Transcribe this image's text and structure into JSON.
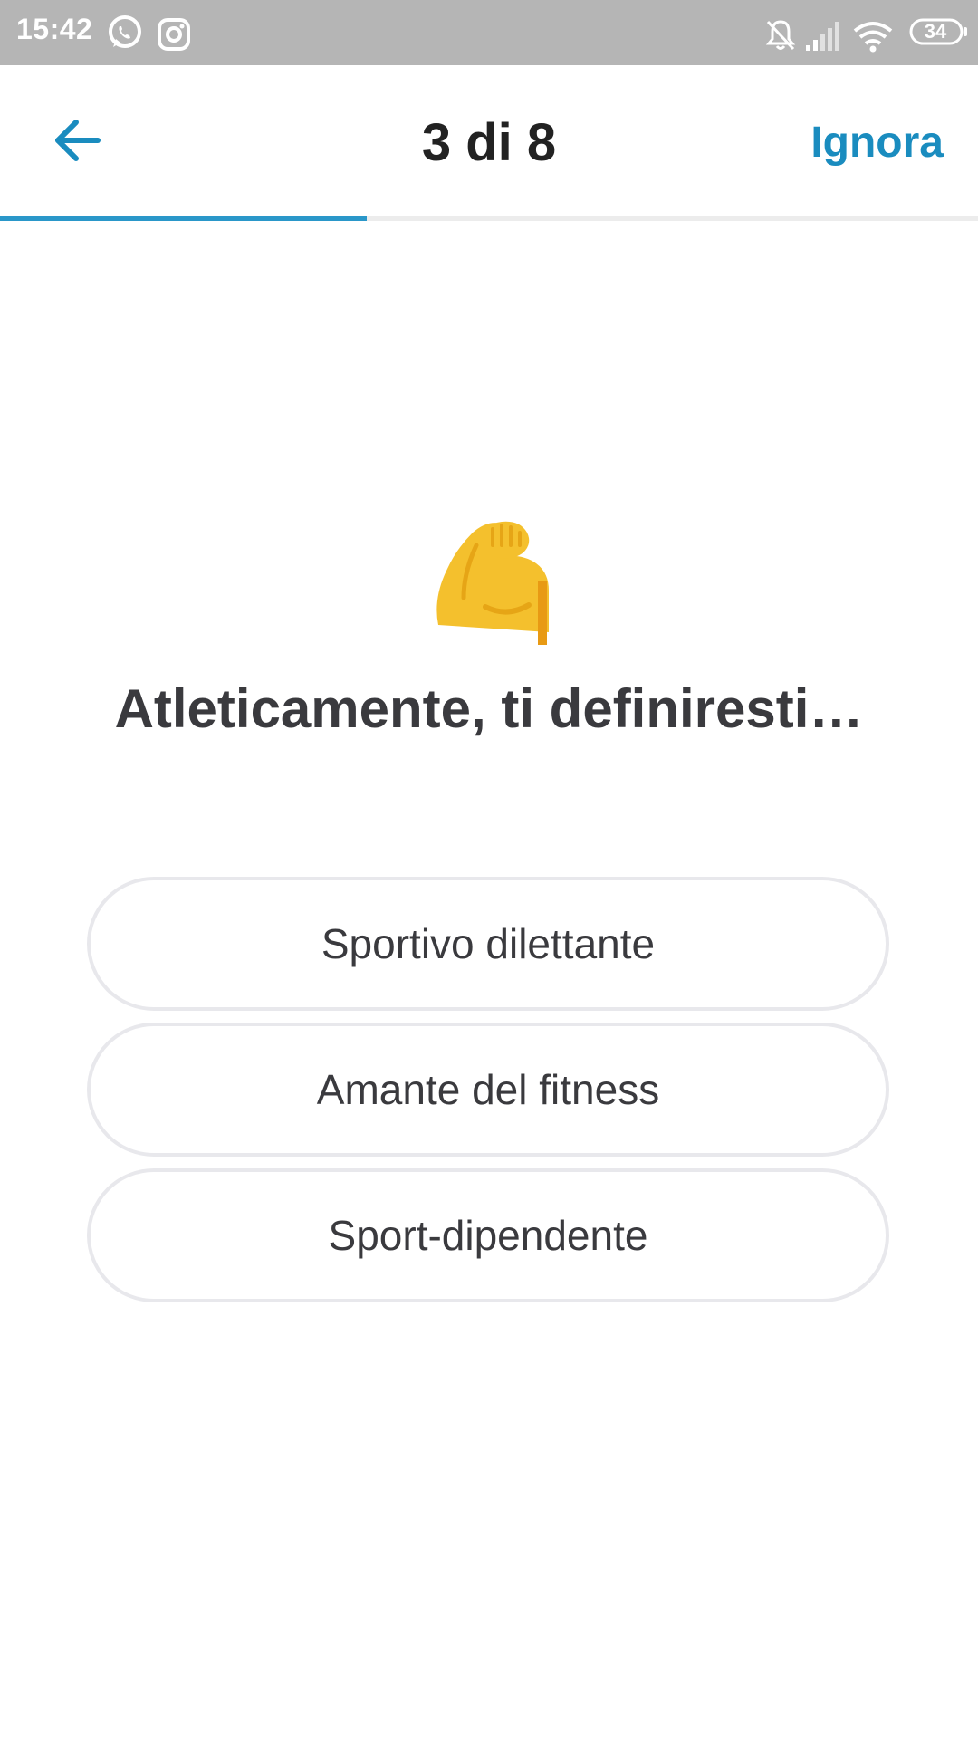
{
  "status_bar": {
    "time": "15:42",
    "battery": "34",
    "icons": [
      "whatsapp-icon",
      "instagram-icon",
      "bell-off-icon",
      "signal-icon",
      "wifi-icon",
      "battery-icon"
    ]
  },
  "header": {
    "back_icon": "arrow-left-icon",
    "counter": "3 di 8",
    "skip_label": "Ignora",
    "progress": 0.375
  },
  "question": {
    "emoji": "flexed-biceps-icon",
    "title": "Atleticamente, ti definiresti…"
  },
  "options": [
    {
      "label": "Sportivo dilettante"
    },
    {
      "label": "Amante del fitness"
    },
    {
      "label": "Sport-dipendente"
    }
  ],
  "colors": {
    "accent": "#1a8cbf",
    "progress": "#2a97c9",
    "status_bar": "#b5b5b5",
    "text": "#3a3a3e",
    "border": "#e8e8ec"
  }
}
